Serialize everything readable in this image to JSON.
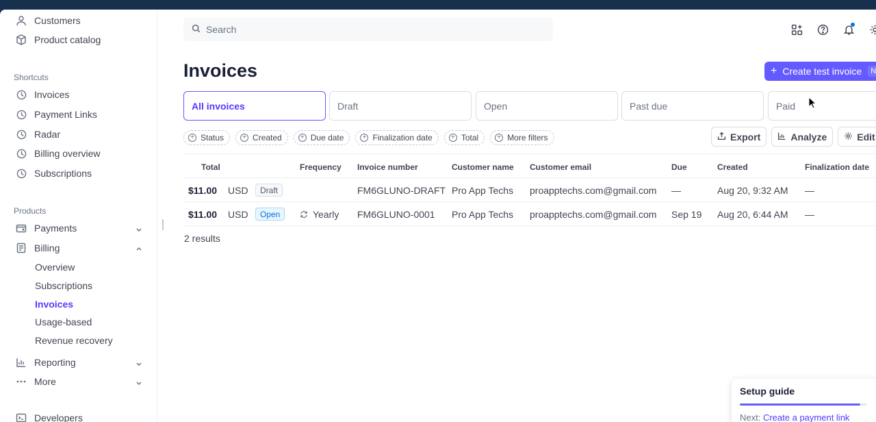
{
  "sidebar": {
    "top_items": [
      {
        "label": "Customers",
        "icon": "person-icon"
      },
      {
        "label": "Product catalog",
        "icon": "box-icon"
      }
    ],
    "shortcuts_heading": "Shortcuts",
    "shortcuts": [
      {
        "label": "Invoices",
        "icon": "clock-icon"
      },
      {
        "label": "Payment Links",
        "icon": "clock-icon"
      },
      {
        "label": "Radar",
        "icon": "clock-icon"
      },
      {
        "label": "Billing overview",
        "icon": "clock-icon"
      },
      {
        "label": "Subscriptions",
        "icon": "clock-icon"
      }
    ],
    "products_heading": "Products",
    "payments": {
      "label": "Payments",
      "icon": "wallet-icon"
    },
    "billing": {
      "label": "Billing",
      "icon": "billing-icon",
      "subitems": [
        "Overview",
        "Subscriptions",
        "Invoices",
        "Usage-based",
        "Revenue recovery"
      ],
      "active": "Invoices"
    },
    "reporting": {
      "label": "Reporting",
      "icon": "bar-chart-icon"
    },
    "more": {
      "label": "More",
      "icon": "ellipsis-icon"
    },
    "developers": {
      "label": "Developers",
      "icon": "terminal-icon"
    }
  },
  "header": {
    "search_placeholder": "Search",
    "icons": [
      "apps-icon",
      "help-icon",
      "bell-icon",
      "gear-icon"
    ]
  },
  "page": {
    "title": "Invoices",
    "create_button": "Create test invoice",
    "create_shortcut": "N"
  },
  "tabs": [
    {
      "label": "All invoices",
      "active": true
    },
    {
      "label": "Draft",
      "active": false
    },
    {
      "label": "Open",
      "active": false
    },
    {
      "label": "Past due",
      "active": false
    },
    {
      "label": "Paid",
      "active": false
    }
  ],
  "filters": [
    "Status",
    "Created",
    "Due date",
    "Finalization date",
    "Total",
    "More filters"
  ],
  "actions": {
    "export": "Export",
    "analyze": "Analyze",
    "edit_columns": "Edit co"
  },
  "table": {
    "columns": [
      "Total",
      "Frequency",
      "Invoice number",
      "Customer name",
      "Customer email",
      "Due",
      "Created",
      "Finalization date"
    ],
    "rows": [
      {
        "amount": "$11.00",
        "currency": "USD",
        "status": "Draft",
        "frequency": "",
        "number": "FM6GLUNO-DRAFT",
        "customer": "Pro App Techs",
        "email": "proapptechs.com@gmail.com",
        "due": "—",
        "created": "Aug 20, 9:32 AM",
        "finalized": "—"
      },
      {
        "amount": "$11.00",
        "currency": "USD",
        "status": "Open",
        "frequency": "Yearly",
        "number": "FM6GLUNO-0001",
        "customer": "Pro App Techs",
        "email": "proapptechs.com@gmail.com",
        "due": "Sep 19",
        "created": "Aug 20, 6:44 AM",
        "finalized": "—"
      }
    ],
    "results": "2 results"
  },
  "setup_guide": {
    "title": "Setup guide",
    "progress": 0.95,
    "next_prefix": "Next:",
    "next_link": "Create a payment link"
  },
  "colors": {
    "accent": "#635bff",
    "open_badge": "#0570de"
  }
}
